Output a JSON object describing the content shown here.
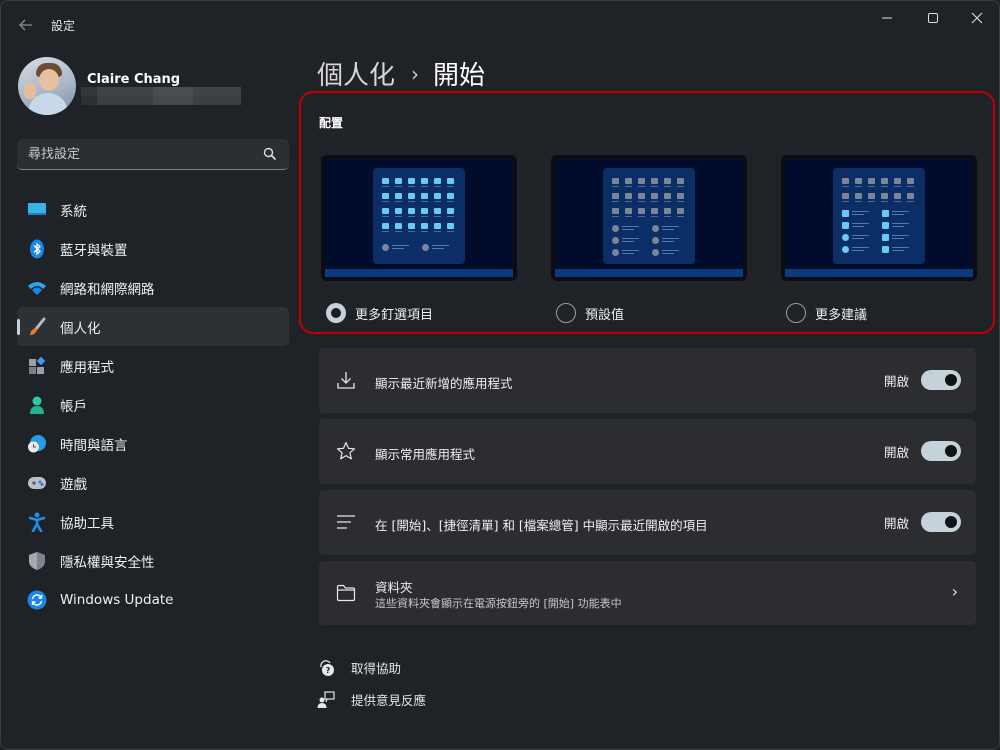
{
  "window": {
    "title": "設定",
    "controls": [
      "minimize",
      "maximize",
      "close"
    ]
  },
  "user": {
    "name": "Claire Chang",
    "email": ""
  },
  "search": {
    "placeholder": "尋找設定"
  },
  "sidebar": {
    "items": [
      {
        "label": "系統",
        "icon": "system-icon",
        "active": false
      },
      {
        "label": "藍牙與裝置",
        "icon": "bluetooth-icon",
        "active": false
      },
      {
        "label": "網路和網際網路",
        "icon": "wifi-icon",
        "active": false
      },
      {
        "label": "個人化",
        "icon": "paintbrush-icon",
        "active": true
      },
      {
        "label": "應用程式",
        "icon": "apps-icon",
        "active": false
      },
      {
        "label": "帳戶",
        "icon": "account-icon",
        "active": false
      },
      {
        "label": "時間與語言",
        "icon": "time-language-icon",
        "active": false
      },
      {
        "label": "遊戲",
        "icon": "gamepad-icon",
        "active": false
      },
      {
        "label": "協助工具",
        "icon": "accessibility-icon",
        "active": false
      },
      {
        "label": "隱私權與安全性",
        "icon": "shield-icon",
        "active": false
      },
      {
        "label": "Windows Update",
        "icon": "windows-update-icon",
        "active": false
      }
    ]
  },
  "breadcrumb": {
    "parent": "個人化",
    "separator": "›",
    "current": "開始"
  },
  "layout": {
    "title": "配置",
    "options": [
      {
        "label": "更多釘選項目",
        "selected": true
      },
      {
        "label": "預設值",
        "selected": false
      },
      {
        "label": "更多建議",
        "selected": false
      }
    ]
  },
  "settings": [
    {
      "label": "顯示最近新增的應用程式",
      "icon": "download-icon",
      "state_label": "開啟",
      "on": true
    },
    {
      "label": "顯示常用應用程式",
      "icon": "star-icon",
      "state_label": "開啟",
      "on": true
    },
    {
      "label": "在 [開始]、[捷徑清單] 和 [檔案總管] 中顯示最近開啟的項目",
      "icon": "list-icon",
      "state_label": "開啟",
      "on": true
    },
    {
      "label": "資料夾",
      "sublabel": "這些資料夾會顯示在電源按鈕旁的 [開始] 功能表中",
      "icon": "folder-icon",
      "chevron": "›"
    }
  ],
  "footer": {
    "links": [
      {
        "label": "取得協助",
        "icon": "help-icon"
      },
      {
        "label": "提供意見反應",
        "icon": "feedback-icon"
      }
    ]
  },
  "colors": {
    "highlight_border": "#c00000",
    "toggle_on": "#c6d2da",
    "preview_tile_active": "#6bc9f5",
    "preview_tile_inactive": "#7b8798"
  }
}
